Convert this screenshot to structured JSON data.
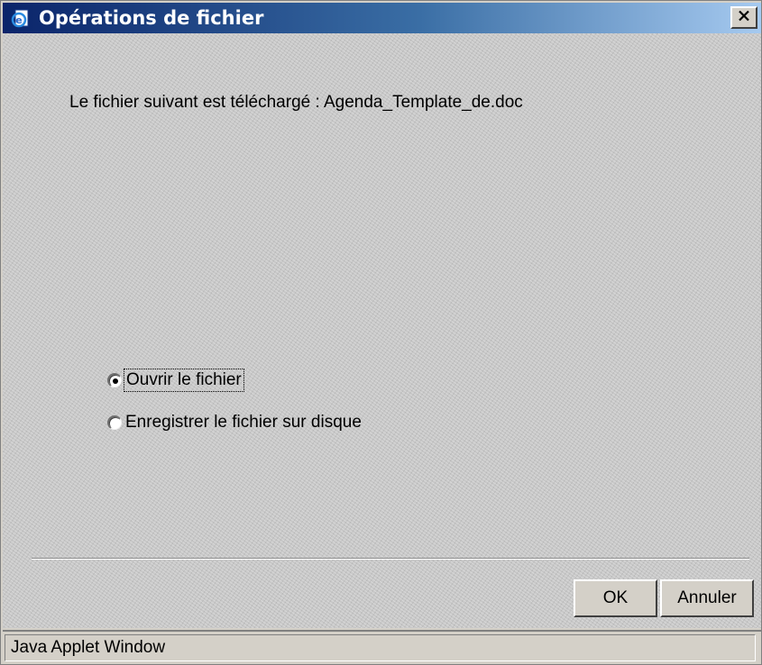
{
  "window": {
    "title": "Opérations de fichier",
    "close_label": "×"
  },
  "message": "Le fichier suivant est téléchargé : Agenda_Template_de.doc",
  "options": [
    {
      "label": "Ouvrir le fichier",
      "selected": true
    },
    {
      "label": "Enregistrer le fichier sur disque",
      "selected": false
    }
  ],
  "buttons": {
    "ok_label": "OK",
    "cancel_label": "Annuler"
  },
  "status_bar": {
    "text": "Java Applet Window"
  },
  "colors": {
    "titlebar_start": "#0a246a",
    "titlebar_end": "#a6caf0",
    "face": "#d4d0c8"
  },
  "icons": {
    "title": "ie-document-icon",
    "close": "close-icon"
  }
}
